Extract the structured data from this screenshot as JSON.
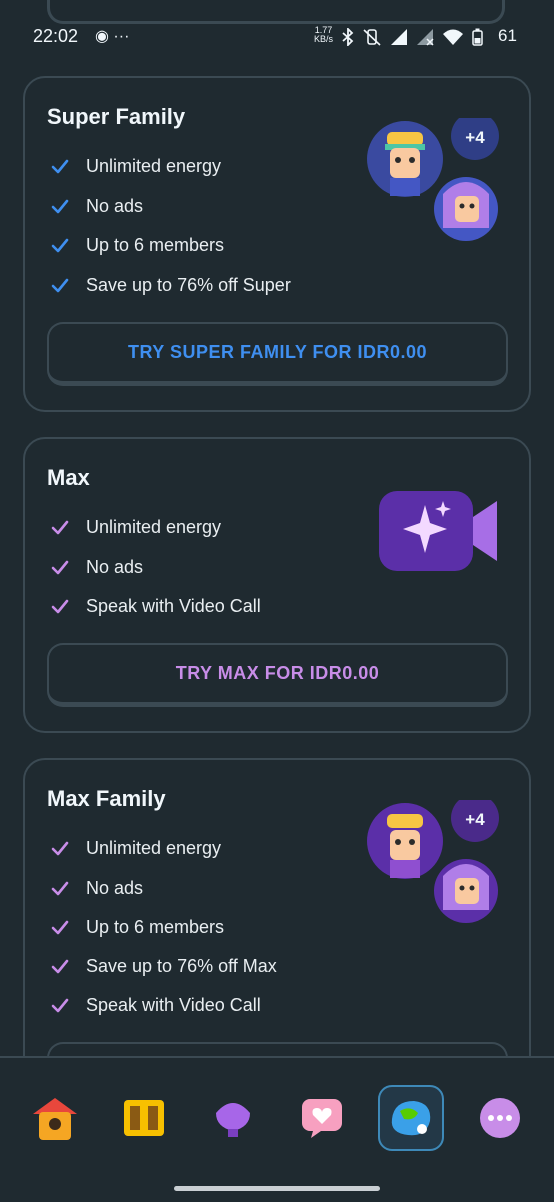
{
  "status_bar": {
    "time": "22:02",
    "left_icons": "◉ ···",
    "speed_value": "1.77",
    "speed_unit": "KB/s",
    "battery": "61"
  },
  "cards": [
    {
      "title": "Super Family",
      "check_color": "#3f8ff0",
      "features": [
        "Unlimited energy",
        "No ads",
        "Up to 6 members",
        "Save up to 76% off Super"
      ],
      "badge": "+4",
      "cta": "TRY SUPER FAMILY FOR IDR0.00",
      "cta_color": "#3f8ff0"
    },
    {
      "title": "Max",
      "check_color": "#c88de8",
      "features": [
        "Unlimited energy",
        "No ads",
        "Speak with Video Call"
      ],
      "cta": "TRY MAX FOR IDR0.00",
      "cta_color": "#c88de8"
    },
    {
      "title": "Max Family",
      "check_color": "#c88de8",
      "features": [
        "Unlimited energy",
        "No ads",
        "Up to 6 members",
        "Save up to 76% off Max",
        "Speak with Video Call"
      ],
      "badge": "+4"
    }
  ],
  "nav": [
    "home-icon",
    "chest-icon",
    "league-shell-icon",
    "heart-message-icon",
    "globe-avatar-icon",
    "more-icon"
  ]
}
